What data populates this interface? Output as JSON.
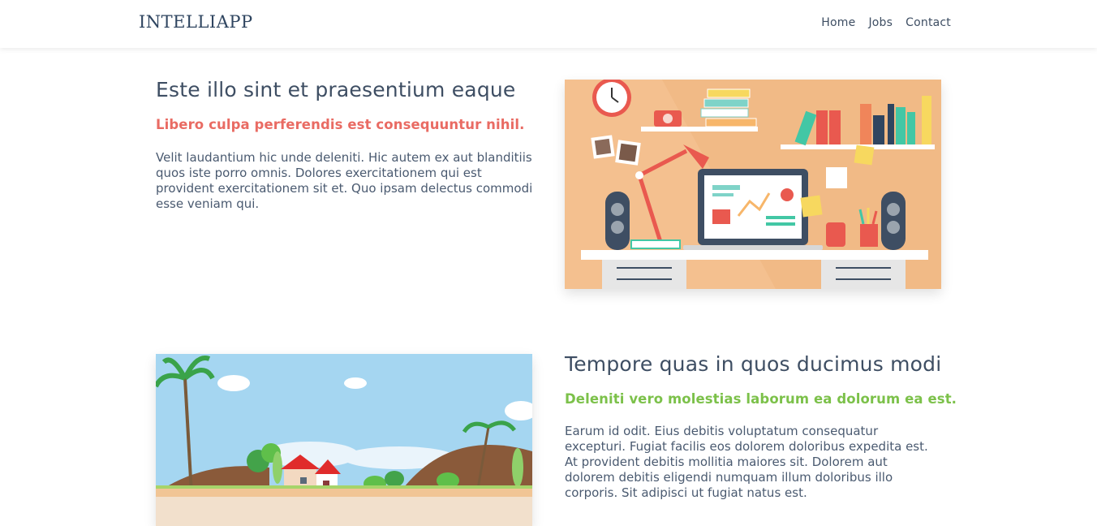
{
  "navbar": {
    "logo": "INTELLIAPP",
    "links": [
      "Home",
      "Jobs",
      "Contact"
    ]
  },
  "section1": {
    "title": "Este illo sint et praesentium eaque",
    "subtitle": "Libero culpa perferendis est consequuntur nihil.",
    "body": "Velit laudantium hic unde deleniti. Hic autem ex aut blanditiis quos iste porro omnis. Dolores exercitationem qui est provident exercitationem sit et. Quo ipsam delectus commodi esse veniam qui.",
    "image": "workspace-desk-illustration"
  },
  "section2": {
    "title": "Tempore quas in quos ducimus modi",
    "subtitle": "Deleniti vero molestias laborum ea dolorum ea est.",
    "body": "Earum id odit. Eius debitis voluptatum consequatur excepturi. Fugiat facilis eos dolorem doloribus expedita est. At provident debitis mollitia maiores sit. Dolorem aut dolorem debitis eligendi numquam illum doloribus illo corporis. Sit adipisci ut fugiat natus est.",
    "image": "countryside-house-illustration"
  },
  "colors": {
    "accent_red": "#e96b63",
    "accent_green": "#7cc14a",
    "text_dark": "#3e4e63"
  }
}
